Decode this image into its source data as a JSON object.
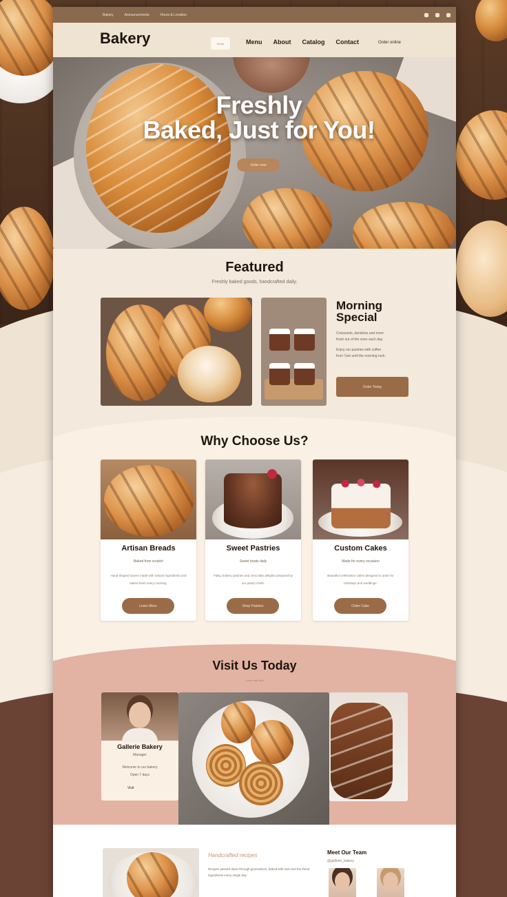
{
  "topbar": {
    "items": [
      "Bakery",
      "Announcements",
      "Hours & Location"
    ]
  },
  "nav": {
    "brand": "Bakery",
    "pill": "Home",
    "links": [
      "Menu",
      "About",
      "Catalog",
      "Contact"
    ],
    "extra": "Order online"
  },
  "hero": {
    "title_line1": "Freshly",
    "title_line2": "Baked, Just for You!",
    "button": "Order now"
  },
  "featured": {
    "title": "Featured",
    "subtitle": "Freshly baked goods, handcrafted daily.",
    "special_title": "Morning Special",
    "special_lines": [
      "Croissants, danishes and more",
      "fresh out of the oven each day.",
      "Enjoy our pastries with coffee",
      "from 7am until the morning rush."
    ],
    "special_button": "Order Today"
  },
  "why": {
    "title": "Why Choose Us?",
    "cards": [
      {
        "title": "Artisan Breads",
        "sub": "Baked from scratch",
        "body": "Hand-shaped loaves made with natural ingredients and baked fresh every morning.",
        "button": "Learn More"
      },
      {
        "title": "Sweet Pastries",
        "sub": "Sweet treats daily",
        "body": "Flaky, buttery pastries and chocolate delights prepared by our pastry chefs.",
        "button": "Shop Pastries"
      },
      {
        "title": "Custom Cakes",
        "sub": "Made for every occasion",
        "body": "Beautiful celebration cakes designed to order for birthdays and weddings.",
        "button": "Order Cake"
      }
    ]
  },
  "visit": {
    "title": "Visit Us Today",
    "subtitle": "Come say hello",
    "card_name": "Gallerie Bakery",
    "card_line1": "Manager",
    "card_line2": "Welcome to our bakery",
    "card_line3": "Open 7 days",
    "card_foot": "Visit"
  },
  "bottom": {
    "mid_title": "Handcrafted recipes",
    "mid_text": "Recipes passed down through generations, baked with love and the finest ingredients every single day.",
    "right_title": "Meet Our Team",
    "right_sub": "@gallerie_bakery"
  }
}
